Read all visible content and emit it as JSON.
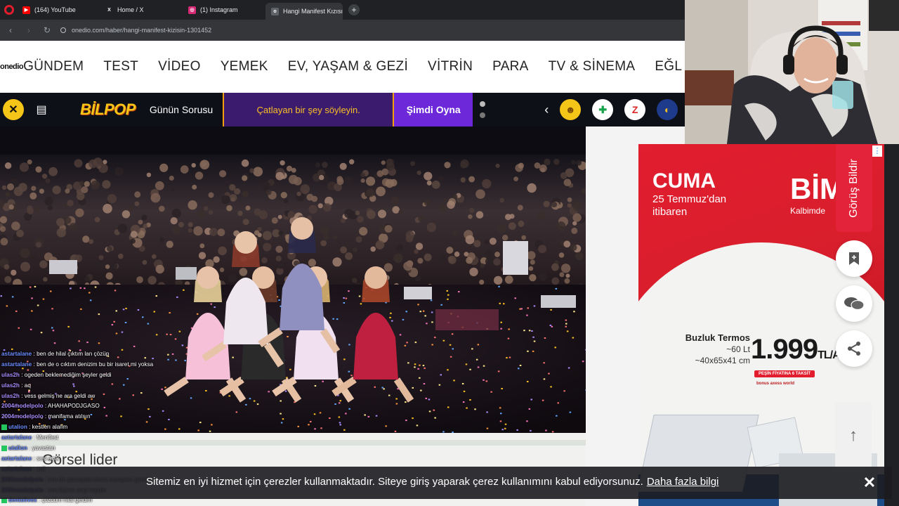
{
  "browser": {
    "tabs": [
      {
        "label": "(164) YouTube",
        "favicon": "youtube-icon",
        "color": "#ff0000",
        "glyph": "▶"
      },
      {
        "label": "Home / X",
        "favicon": "x-icon",
        "color": "#202124",
        "glyph": "X"
      },
      {
        "label": "(1) Instagram",
        "favicon": "instagram-icon",
        "color": "#d62976",
        "glyph": "◎"
      },
      {
        "label": "Hangi Manifest Kızısın? -",
        "favicon": "onedio-icon",
        "color": "#5f6368",
        "glyph": "o",
        "active": true
      }
    ],
    "url": "onedio.com/haber/hangi-manifest-kizisin-1301452"
  },
  "site": {
    "logo": "onedio",
    "nav": [
      "GÜNDEM",
      "TEST",
      "VİDEO",
      "YEMEK",
      "EV, YAŞAM & GEZİ",
      "VİTRİN",
      "PARA",
      "TV & SİNEMA",
      "EĞL"
    ]
  },
  "gamebar": {
    "brand": "BİLPOP",
    "daily": "Günün Sorusu",
    "question": "Çatlayan bir şey söyleyin.",
    "play": "Şimdi Oyna",
    "right_icons": [
      {
        "name": "emoji-face-icon",
        "bg": "#f5c518",
        "glyph": "☻",
        "color": "#7a4b00"
      },
      {
        "name": "plus-game-icon",
        "bg": "#ffffff",
        "glyph": "✚",
        "color": "#16a34a"
      },
      {
        "name": "z-game-icon",
        "bg": "#ffffff",
        "glyph": "Z",
        "color": "#dc2626"
      },
      {
        "name": "turkcell-icon",
        "bg": "#1e3a8a",
        "glyph": "◐",
        "color": "#fbbf24"
      }
    ]
  },
  "article": {
    "section_title": "Görsel lider"
  },
  "ad": {
    "headline": "CUMA",
    "date_line1": "25 Temmuz'dan",
    "date_line2": "itibaren",
    "brand": "BİM",
    "tagline": "Kalbimde",
    "product": "Buzluk Termos",
    "spec1": "~60 Lt",
    "spec2": "~40x65x41 cm",
    "price": "1.999",
    "currency": "TL/AD",
    "installment": "PEŞİN FİYATINA 6 TAKSİT",
    "brands_line": "bonus  axess  world"
  },
  "side": {
    "feedback_label": "Görüş Bildir",
    "bookmark": "bookmark-icon",
    "comments": "comments-icon",
    "share": "share-icon",
    "scroll_top": "arrow-up-icon"
  },
  "cookie": {
    "text": "Sitemiz en iyi hizmet için çerezler kullanmaktadır. Siteye giriş yaparak çerez kullanımını kabul ediyorsunuz.",
    "link": "Daha fazla bilgi",
    "close": "✕"
  },
  "chat": [
    {
      "user": "astartalane",
      "msg": " : ben de hilal çıktım lan çözüp",
      "color": "#6b8cff"
    },
    {
      "user": "astartalane",
      "msg": " : ben de o cıktım denizim bu bir isaret mi yoksa",
      "color": "#6b8cff"
    },
    {
      "user": "ulas2h",
      "msg": " : ogeden beklemediğim şeyler geldi",
      "color": "#a78bfa"
    },
    {
      "user": "ulas2h",
      "msg": " : aq",
      "color": "#a78bfa"
    },
    {
      "user": "ulas2h",
      "msg": " : vess gelmiş ne ara geldi aw",
      "color": "#a78bfa"
    },
    {
      "user": "2004modelpolo",
      "msg": " : AHAHAPODJGASO",
      "color": "#a78bfa"
    },
    {
      "user": "2004modelpolo",
      "msg": " : manifama atılsın",
      "color": "#a78bfa"
    },
    {
      "user": "utalion",
      "msg": " : kestlerı alalım",
      "color": "#6b8cff",
      "badge": true
    },
    {
      "user": "astartalane",
      "msg": " : Menifest",
      "color": "#6b8cff"
    },
    {
      "user": "utalion",
      "msg": " : yavastan",
      "color": "#6b8cff",
      "badge": true
    },
    {
      "user": "astartalane",
      "msg": " : sesi açık",
      "color": "#6b8cff"
    },
    {
      "user": "astartalane",
      "msg": " : acil",
      "color": "#6b8cff"
    },
    {
      "user": "2004modelpolo",
      "msg": " : sen de çözseydin deniz cevapları gördük",
      "color": "#a78bfa"
    },
    {
      "user": "2004modelpolo",
      "msg": " : sen lidyacı degi miydin",
      "color": "#a78bfa"
    },
    {
      "user": "dentolivex",
      "msg": " : çözdüm hilal geldim",
      "color": "#6b8cff",
      "badge": true
    }
  ]
}
